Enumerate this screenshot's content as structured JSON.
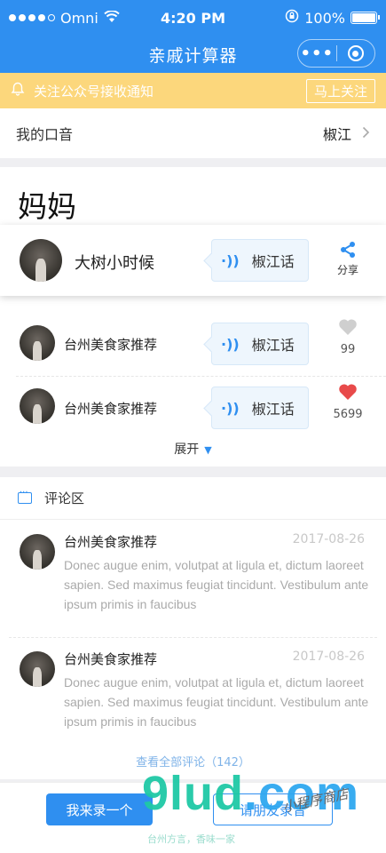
{
  "status_bar": {
    "carrier": "Omni",
    "time": "4:20 PM",
    "battery": "100%",
    "battery_level": 1.0
  },
  "nav": {
    "title": "亲戚计算器",
    "more_icon": "more-dots-icon",
    "close_icon": "target-close-icon"
  },
  "notice": {
    "text": "关注公众号接收通知",
    "button": "马上关注",
    "icon": "bell-icon"
  },
  "accent": {
    "label": "我的口音",
    "value": "椒江"
  },
  "relative": {
    "title": "妈妈"
  },
  "featured": {
    "name": "大树小时候",
    "dialect": "椒江话",
    "share_label": "分享",
    "share_icon": "share-icon"
  },
  "recordings": [
    {
      "name": "台州美食家推荐",
      "dialect": "椒江话",
      "likes": "99",
      "liked": false
    },
    {
      "name": "台州美食家推荐",
      "dialect": "椒江话",
      "likes": "5699",
      "liked": true
    }
  ],
  "expand": {
    "label": "展开"
  },
  "comments": {
    "header": "评论区",
    "items": [
      {
        "name": "台州美食家推荐",
        "date": "2017-08-26",
        "body": "Donec augue enim, volutpat at ligula et, dictum laoreet sapien. Sed maximus feugiat tincidunt. Vestibulum ante ipsum primis in faucibus"
      },
      {
        "name": "台州美食家推荐",
        "date": "2017-08-26",
        "body": "Donec augue enim, volutpat at ligula et, dictum laoreet sapien. Sed maximus feugiat tincidunt. Vestibulum ante ipsum primis in faucibus"
      }
    ],
    "view_all": "查看全部评论（142）"
  },
  "bottom": {
    "record": "我来录一个",
    "invite": "请朋友录音"
  },
  "watermark": {
    "brand": "9lud",
    "tld": ".com",
    "tagline": "台州方言，香味一家",
    "handwriting": "小程序商店"
  },
  "colors": {
    "primary": "#2f8ff0",
    "notice_bg": "#fcd77c",
    "like_red": "#e84a4a",
    "like_gray": "#cfcfcf"
  }
}
